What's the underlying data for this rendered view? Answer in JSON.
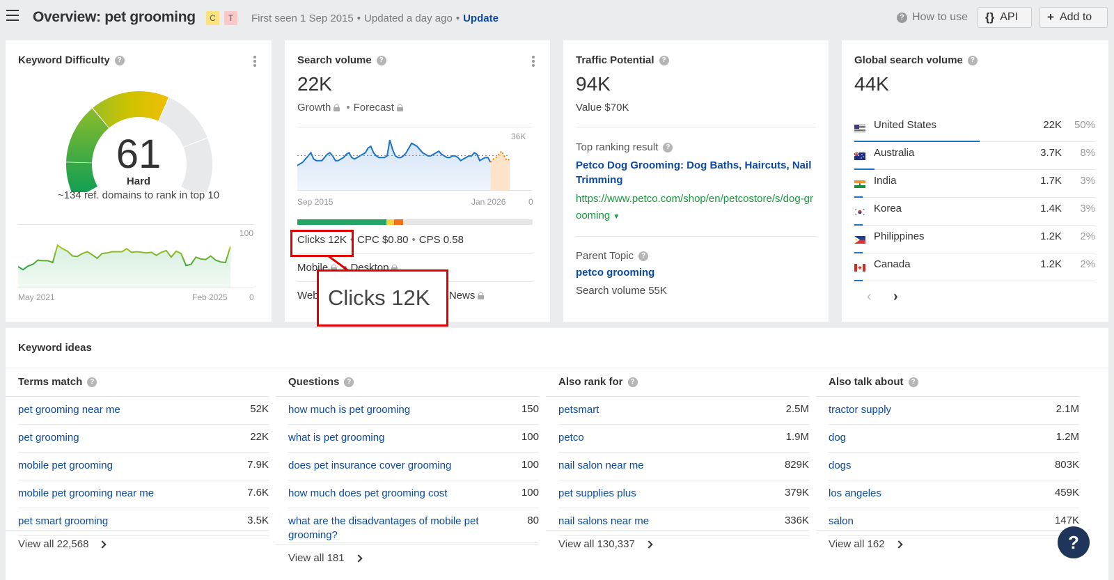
{
  "header": {
    "title": "Overview: pet grooming",
    "badges": [
      "C",
      "T"
    ],
    "first_seen": "First seen 1 Sep 2015",
    "updated": "Updated a day ago",
    "update_link": "Update",
    "how_to_use": "How to use",
    "api_button": "API",
    "add_to_button": "Add to"
  },
  "keyword_difficulty": {
    "title": "Keyword Difficulty",
    "value": "61",
    "label": "Hard",
    "subtext": "~134 ref. domains to rank in top 10",
    "score_fraction": 0.61,
    "chart": {
      "x_start": "May 2021",
      "x_end": "Feb 2025",
      "y_max": "100",
      "y_min": "0",
      "values": [
        36,
        31,
        37,
        40,
        47,
        46,
        46,
        43,
        72,
        66,
        62,
        54,
        53,
        58,
        61,
        56,
        50,
        58,
        59,
        61,
        61,
        61,
        66,
        60,
        61,
        60,
        59,
        60,
        55,
        60,
        63,
        52,
        62,
        58,
        38,
        40,
        52,
        49,
        48,
        54,
        47,
        44,
        43,
        70
      ]
    }
  },
  "search_volume": {
    "title": "Search volume",
    "value": "22K",
    "growth": "Growth",
    "forecast": "Forecast",
    "chart": {
      "x_start": "Sep 2015",
      "x_end": "Jan 2026",
      "y_max": "36K",
      "y_min": "0",
      "values_k": [
        16,
        17,
        18,
        20,
        22,
        24,
        20,
        19,
        19,
        19,
        21,
        23,
        24,
        22,
        19,
        19,
        20,
        21,
        23,
        24,
        21,
        20,
        21,
        22,
        23,
        24,
        27,
        28,
        24,
        22,
        21,
        21,
        21,
        22,
        32,
        26,
        22,
        21,
        21,
        22,
        24,
        27,
        30,
        29,
        28,
        26,
        24,
        23,
        22,
        22,
        23,
        24,
        25,
        23,
        22,
        21,
        21,
        22,
        22,
        21,
        19,
        20,
        21,
        22,
        22,
        24,
        23,
        19,
        20,
        21,
        21,
        18
      ],
      "forecast_k": [
        20,
        21,
        23,
        25,
        22,
        19,
        20
      ]
    },
    "intent_segments": [
      {
        "color": "#22a565",
        "fraction": 0.38
      },
      {
        "color": "#f5d33f",
        "fraction": 0.03
      },
      {
        "color": "#f2711c",
        "fraction": 0.04
      }
    ],
    "clicks": "Clicks 12K",
    "cpc": "CPC $0.80",
    "cps": "CPS 0.58",
    "mobile": "Mobile",
    "desktop": "Desktop",
    "web": "Web",
    "news": "News",
    "zoom_callout": "Clicks 12K"
  },
  "traffic_potential": {
    "title": "Traffic Potential",
    "value": "94K",
    "value_usd": "Value $70K",
    "top_ranking_label": "Top ranking result",
    "top_ranking_title": "Petco Dog Grooming: Dog Baths, Haircuts, Nail Trimming",
    "top_ranking_url": "https://www.petco.com/shop/en/petcostore/s/dog-grooming",
    "parent_topic_label": "Parent Topic",
    "parent_topic": "petco grooming",
    "parent_volume": "Search volume 55K"
  },
  "global_volume": {
    "title": "Global search volume",
    "value": "44K",
    "countries": [
      {
        "name": "United States",
        "volume": "22K",
        "pct": "50%",
        "share": 0.5,
        "flag": "us"
      },
      {
        "name": "Australia",
        "volume": "3.7K",
        "pct": "8%",
        "share": 0.08,
        "flag": "au"
      },
      {
        "name": "India",
        "volume": "1.7K",
        "pct": "3%",
        "share": 0.03,
        "flag": "in"
      },
      {
        "name": "Korea",
        "volume": "1.4K",
        "pct": "3%",
        "share": 0.03,
        "flag": "kr"
      },
      {
        "name": "Philippines",
        "volume": "1.2K",
        "pct": "2%",
        "share": 0.02,
        "flag": "ph"
      },
      {
        "name": "Canada",
        "volume": "1.2K",
        "pct": "2%",
        "share": 0.02,
        "flag": "ca"
      }
    ]
  },
  "keyword_ideas": {
    "title": "Keyword ideas",
    "columns": [
      {
        "title": "Terms match",
        "items": [
          {
            "kw": "pet grooming near me",
            "v": "52K"
          },
          {
            "kw": "pet grooming",
            "v": "22K"
          },
          {
            "kw": "mobile pet grooming",
            "v": "7.9K"
          },
          {
            "kw": "mobile pet grooming near me",
            "v": "7.6K"
          },
          {
            "kw": "pet smart grooming",
            "v": "3.5K"
          }
        ],
        "view_all": "View all 22,568"
      },
      {
        "title": "Questions",
        "items": [
          {
            "kw": "how much is pet grooming",
            "v": "150"
          },
          {
            "kw": "what is pet grooming",
            "v": "100"
          },
          {
            "kw": "does pet insurance cover grooming",
            "v": "100"
          },
          {
            "kw": "how much does pet grooming cost",
            "v": "100"
          },
          {
            "kw": "what are the disadvantages of mobile pet grooming?",
            "v": "80"
          }
        ],
        "view_all": "View all 181"
      },
      {
        "title": "Also rank for",
        "items": [
          {
            "kw": "petsmart",
            "v": "2.5M"
          },
          {
            "kw": "petco",
            "v": "1.9M"
          },
          {
            "kw": "nail salon near me",
            "v": "829K"
          },
          {
            "kw": "pet supplies plus",
            "v": "379K"
          },
          {
            "kw": "nail salons near me",
            "v": "336K"
          }
        ],
        "view_all": "View all 130,337"
      },
      {
        "title": "Also talk about",
        "items": [
          {
            "kw": "tractor supply",
            "v": "2.1M"
          },
          {
            "kw": "dog",
            "v": "1.2M"
          },
          {
            "kw": "dogs",
            "v": "803K"
          },
          {
            "kw": "los angeles",
            "v": "459K"
          },
          {
            "kw": "salon",
            "v": "147K"
          }
        ],
        "view_all": "View all 162"
      }
    ]
  },
  "help_fab": "?"
}
